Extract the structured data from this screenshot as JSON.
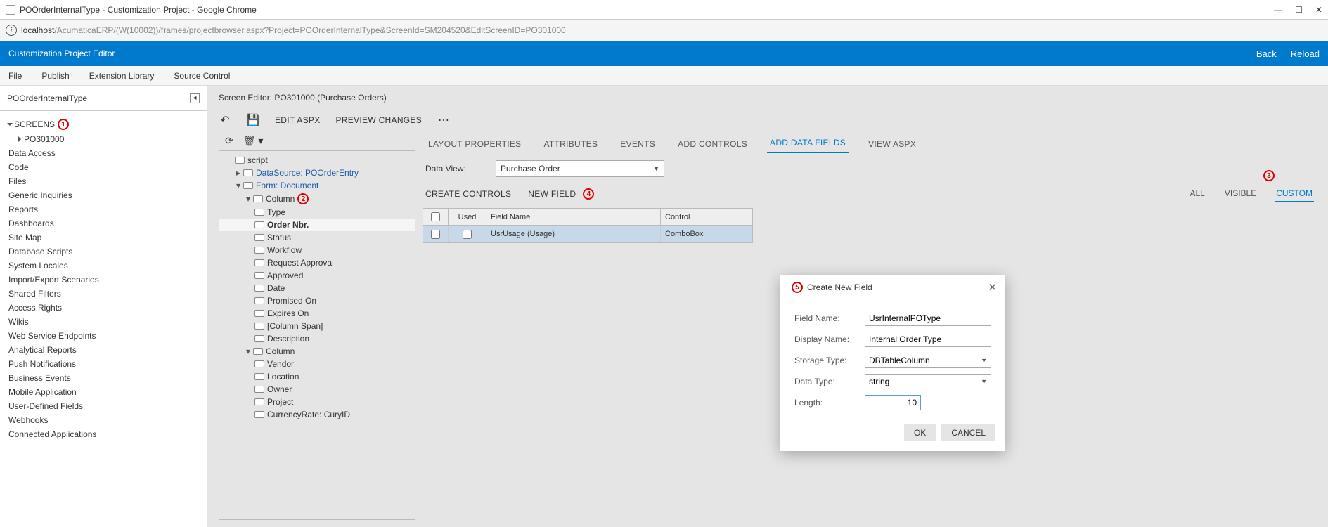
{
  "window": {
    "title": "POOrderInternalType - Customization Project - Google Chrome"
  },
  "url": {
    "host": "localhost",
    "path": "/AcumaticaERP/(W(10002))/frames/projectbrowser.aspx?Project=POOrderInternalType&ScreenId=SM204520&EditScreenID=PO301000"
  },
  "banner": {
    "title": "Customization Project Editor",
    "back": "Back",
    "reload": "Reload"
  },
  "menu": {
    "file": "File",
    "publish": "Publish",
    "ext": "Extension Library",
    "src": "Source Control"
  },
  "project": {
    "name": "POOrderInternalType"
  },
  "nav": {
    "screens": "SCREENS",
    "screen_id": "PO301000",
    "items": [
      "Data Access",
      "Code",
      "Files",
      "Generic Inquiries",
      "Reports",
      "Dashboards",
      "Site Map",
      "Database Scripts",
      "System Locales",
      "Import/Export Scenarios",
      "Shared Filters",
      "Access Rights",
      "Wikis",
      "Web Service Endpoints",
      "Analytical Reports",
      "Push Notifications",
      "Business Events",
      "Mobile Application",
      "User-Defined Fields",
      "Webhooks",
      "Connected Applications"
    ]
  },
  "editor": {
    "title": "Screen Editor: PO301000 (Purchase Orders)",
    "edit_aspx": "EDIT ASPX",
    "preview": "PREVIEW CHANGES",
    "structure": {
      "script": "script",
      "datasource": "DataSource: POOrderEntry",
      "form": "Form: Document",
      "column": "Column",
      "fields1": [
        "Type",
        "Order Nbr.",
        "Status",
        "Workflow",
        "Request Approval",
        "Approved",
        "Date",
        "Promised On",
        "Expires On",
        "[Column Span]",
        "Description"
      ],
      "fields2": [
        "Vendor",
        "Location",
        "Owner",
        "Project",
        "CurrencyRate: CuryID"
      ]
    },
    "tabs": {
      "layout": "LAYOUT PROPERTIES",
      "attrs": "ATTRIBUTES",
      "events": "EVENTS",
      "add_controls": "ADD CONTROLS",
      "add_fields": "ADD DATA FIELDS",
      "view_aspx": "VIEW ASPX"
    },
    "dataview_label": "Data View:",
    "dataview_value": "Purchase Order",
    "create_controls": "CREATE CONTROLS",
    "new_field": "NEW FIELD",
    "filters": {
      "all": "ALL",
      "visible": "VISIBLE",
      "custom": "CUSTOM"
    },
    "grid": {
      "h_used": "Used",
      "h_field": "Field Name",
      "h_control": "Control",
      "row_field": "UsrUsage (Usage)",
      "row_control": "ComboBox"
    }
  },
  "dialog": {
    "title": "Create New Field",
    "l_field": "Field Name:",
    "v_field": "UsrInternalPOType",
    "l_display": "Display Name:",
    "v_display": "Internal Order Type",
    "l_storage": "Storage Type:",
    "v_storage": "DBTableColumn",
    "l_type": "Data Type:",
    "v_type": "string",
    "l_length": "Length:",
    "v_length": "10",
    "ok": "OK",
    "cancel": "CANCEL"
  },
  "badges": {
    "b1": "1",
    "b2": "2",
    "b3": "3",
    "b4": "4",
    "b5": "5"
  }
}
